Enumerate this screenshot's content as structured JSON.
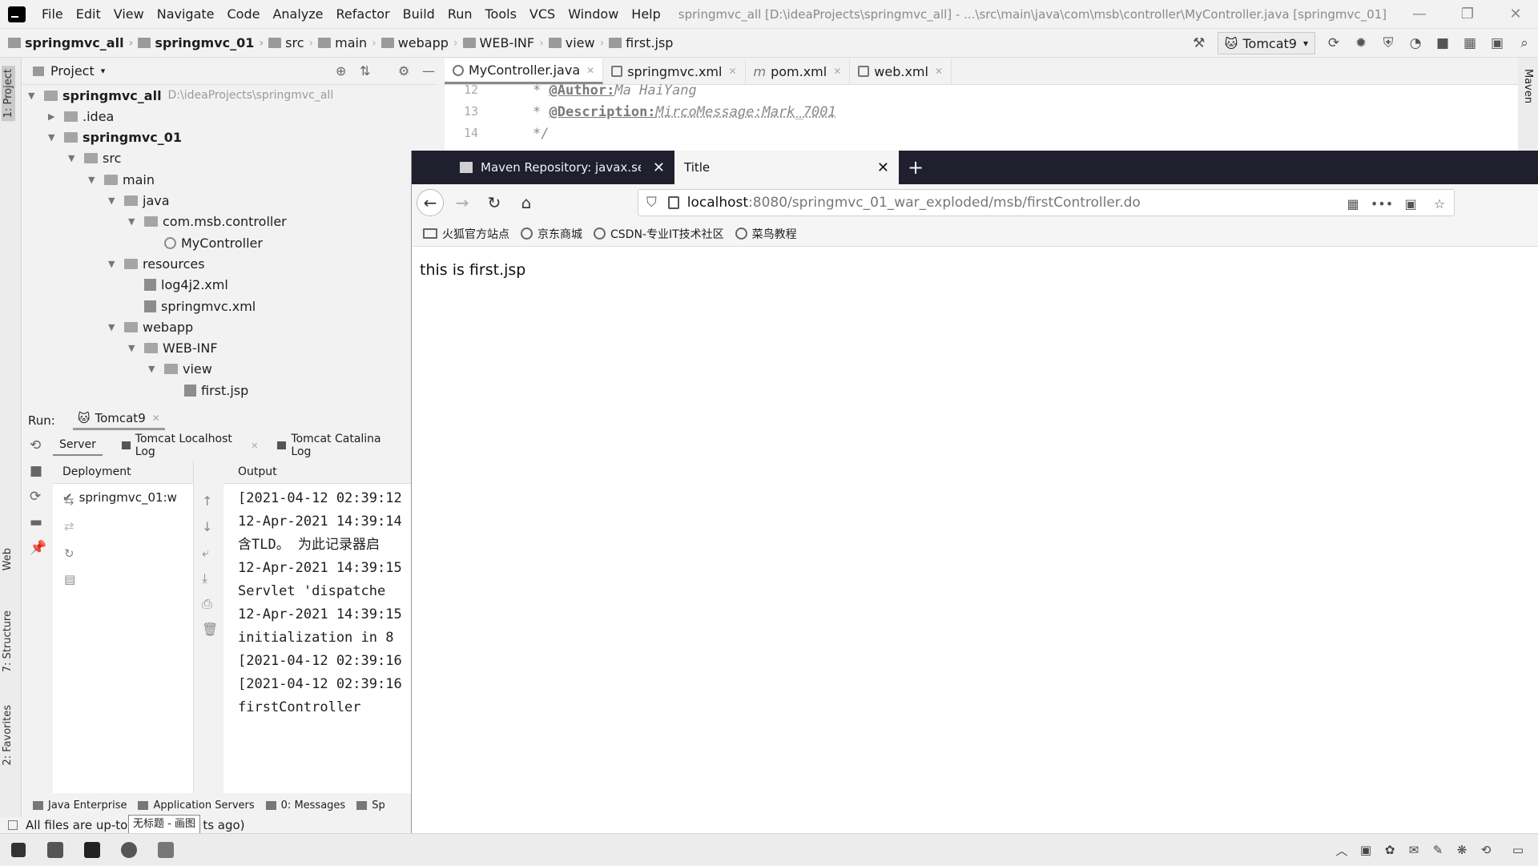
{
  "menubar": {
    "items": [
      "File",
      "Edit",
      "View",
      "Navigate",
      "Code",
      "Analyze",
      "Refactor",
      "Build",
      "Run",
      "Tools",
      "VCS",
      "Window",
      "Help"
    ],
    "window_title": "springmvc_all [D:\\ideaProjects\\springmvc_all] - ...\\src\\main\\java\\com\\msb\\controller\\MyController.java [springmvc_01]"
  },
  "breadcrumb": [
    "springmvc_all",
    "springmvc_01",
    "src",
    "main",
    "webapp",
    "WEB-INF",
    "view",
    "first.jsp"
  ],
  "run_config": "Tomcat9",
  "project": {
    "header": "Project",
    "tree": [
      {
        "label": "springmvc_all",
        "extra": "D:\\ideaProjects\\springmvc_all",
        "bold": true
      },
      {
        "label": ".idea"
      },
      {
        "label": "springmvc_01",
        "bold": true
      },
      {
        "label": "src"
      },
      {
        "label": "main"
      },
      {
        "label": "java"
      },
      {
        "label": "com.msb.controller"
      },
      {
        "label": "MyController"
      },
      {
        "label": "resources"
      },
      {
        "label": "log4j2.xml"
      },
      {
        "label": "springmvc.xml"
      },
      {
        "label": "webapp"
      },
      {
        "label": "WEB-INF"
      },
      {
        "label": "view"
      },
      {
        "label": "first.jsp"
      }
    ]
  },
  "left_strip": {
    "project": "1: Project",
    "web": "Web",
    "structure": "7: Structure",
    "favorites": "2: Favorites"
  },
  "editor": {
    "tabs": [
      "MyController.java",
      "springmvc.xml",
      "pom.xml",
      "web.xml"
    ],
    "lines": [
      {
        "num": "12",
        "tag": "@Author:",
        "rest": " Ma HaiYang"
      },
      {
        "num": "13",
        "tag": "@Description:",
        "rest": " MircoMessage:Mark_7001"
      },
      {
        "num": "14",
        "tag": "",
        "rest": "*/"
      }
    ],
    "maven_label": "Maven"
  },
  "run": {
    "label": "Run:",
    "config": "Tomcat9",
    "tabs": [
      "Server",
      "Tomcat Localhost Log",
      "Tomcat Catalina Log"
    ],
    "deployment_header": "Deployment",
    "deployment_item": "springmvc_01:w",
    "output_header": "Output",
    "output_lines": [
      "[2021-04-12 02:39:12",
      "12-Apr-2021 14:39:14",
      " 含TLD。 为此记录器启",
      "12-Apr-2021 14:39:15",
      "  Servlet 'dispatche",
      "12-Apr-2021 14:39:15",
      " initialization in 8",
      "[2021-04-12 02:39:16",
      "[2021-04-12 02:39:16",
      "firstController"
    ]
  },
  "bottom_tools": [
    "Java Enterprise",
    "Application Servers",
    "0: Messages",
    "Sp"
  ],
  "status": {
    "text": "All files are up-to",
    "suffix": "ts ago)",
    "tooltip": "无标题 - 画图"
  },
  "browser": {
    "tabs": [
      "Maven Repository: javax.ser...",
      "Title"
    ],
    "url_host": "localhost",
    "url_path": ":8080/springmvc_01_war_exploded/msb/firstController.do",
    "bookmarks": [
      "火狐官方站点",
      "京东商城",
      "CSDN-专业IT技术社区",
      "菜鸟教程"
    ],
    "page_text": "this is first.jsp"
  }
}
